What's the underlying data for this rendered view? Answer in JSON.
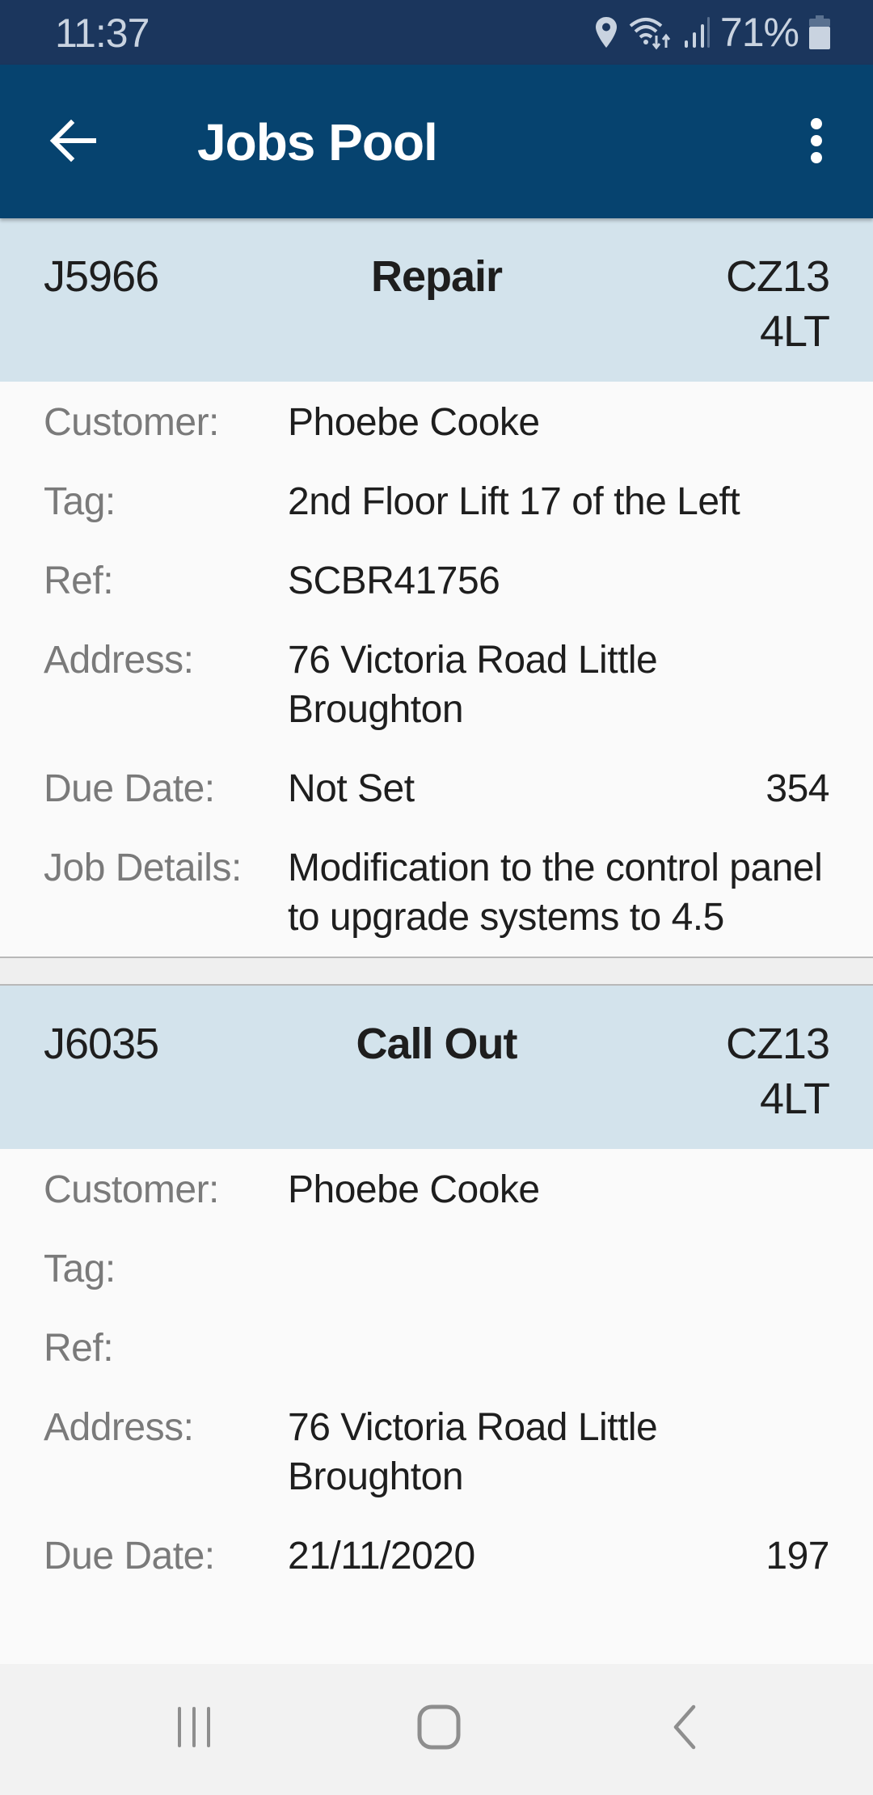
{
  "status_bar": {
    "time": "11:37",
    "icons": [
      "location-icon",
      "wifi-icon",
      "signal-icon",
      "battery-icon"
    ],
    "battery_percent": "71%"
  },
  "app_bar": {
    "title": "Jobs Pool",
    "back_icon": "arrow-left-icon",
    "menu_icon": "more-vert-icon"
  },
  "colors": {
    "status_bar": "#1b365d",
    "app_bar": "#06436f",
    "card_header": "#d3e3ec",
    "label_text": "#7a7a7a",
    "value_text": "#1e1e1e"
  },
  "labels": {
    "customer": "Customer:",
    "tag": "Tag:",
    "ref": "Ref:",
    "address": "Address:",
    "due_date": "Due Date:",
    "job_details": "Job Details:"
  },
  "jobs": [
    {
      "id": "J5966",
      "type": "Repair",
      "postcode": "CZ13 4LT",
      "customer": "Phoebe Cooke",
      "tag": "2nd Floor Lift 17 of the Left",
      "ref": "SCBR41756",
      "address": "76 Victoria Road Little Broughton",
      "due_date": "Not Set",
      "count": "354",
      "job_details": "Modification to the control panel to upgrade systems to 4.5"
    },
    {
      "id": "J6035",
      "type": "Call Out",
      "postcode": "CZ13 4LT",
      "customer": "Phoebe Cooke",
      "tag": "",
      "ref": "",
      "address": "76 Victoria Road Little Broughton",
      "due_date": "21/11/2020",
      "count": "197"
    }
  ],
  "nav_bar": {
    "buttons": [
      "recents-icon",
      "home-icon",
      "back-icon"
    ]
  }
}
